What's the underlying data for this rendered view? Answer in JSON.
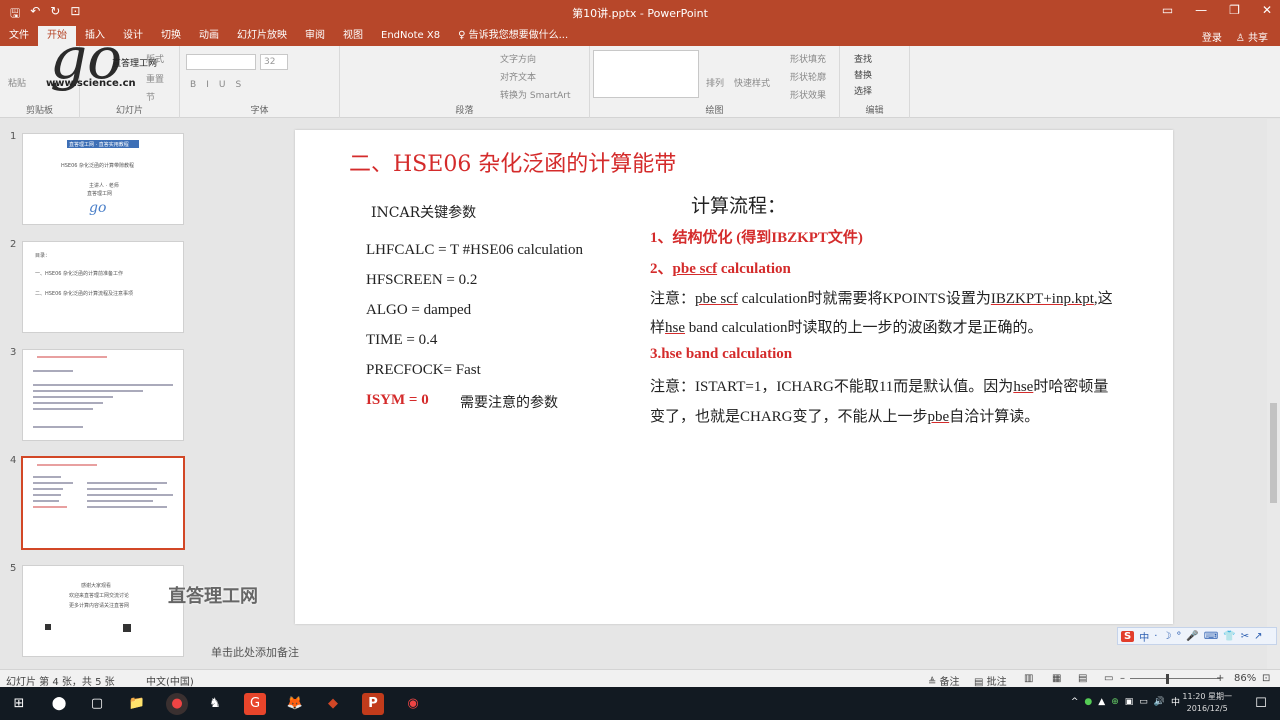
{
  "window": {
    "title": "第10讲.pptx - PowerPoint",
    "controls": [
      "▭",
      "—",
      "❐",
      "✕"
    ]
  },
  "tabs": {
    "items": [
      "文件",
      "开始",
      "插入",
      "设计",
      "切换",
      "动画",
      "幻灯片放映",
      "审阅",
      "视图",
      "EndNote X8",
      "♀ 告诉我您想要做什么..."
    ],
    "active_index": 1,
    "login": "登录",
    "share": "♙ 共享"
  },
  "ribbon": {
    "clipboard": {
      "label": "剪贴板",
      "paste": "粘贴"
    },
    "slides": {
      "label": "幻灯片",
      "new_slide": "新建",
      "layout": "版式",
      "reset": "重置",
      "section": "节",
      "slide": "幻灯片"
    },
    "font": {
      "label": "字体",
      "size": "32",
      "styles": [
        "B",
        "I",
        "U",
        "S",
        "abc",
        "AV",
        "Aa",
        "A"
      ]
    },
    "paragraph": {
      "label": "段落",
      "text_direction": "文字方向",
      "align_text": "对齐文本",
      "smartart": "转换为 SmartArt"
    },
    "drawing": {
      "label": "绘图",
      "arrange": "排列",
      "quick_styles": "快速样式",
      "fill": "形状填充",
      "outline": "形状轮廓",
      "effects": "形状效果"
    },
    "editing": {
      "label": "编辑",
      "find": "查找",
      "replace": "替换",
      "select": "选择"
    }
  },
  "logo": {
    "main": "go",
    "url": "www.science.cn",
    "name": "直答理工网"
  },
  "thumbnails": [
    {
      "num": "1",
      "lines": [
        "直答理工网 · 直答实用教程",
        "HSE06 杂化泛函的计算带隙教程",
        "主讲人 · 老师",
        "直答理工网"
      ],
      "logo": "go"
    },
    {
      "num": "2",
      "lines": [
        "目录：",
        "一、HSE06 杂化泛函的计算前准备工作",
        "二、HSE06 杂化泛函的计算流程及注意事项"
      ]
    },
    {
      "num": "3",
      "lines": []
    },
    {
      "num": "4",
      "lines": [],
      "selected": true
    },
    {
      "num": "5",
      "lines": [
        "感谢大家观看",
        "欢迎来直答理工网交流讨论",
        "更多计算内容请关注直答网"
      ]
    }
  ],
  "slide": {
    "heading": "二、HSE06 杂化泛函的计算能带",
    "incar_title": "INCAR关键参数",
    "params": [
      "LHFCALC = T    #HSE06 calculation",
      "HFSCREEN = 0.2",
      "ALGO = damped",
      "TIME = 0.4",
      "PRECFOCK= Fast"
    ],
    "isym": "ISYM = 0",
    "isym_note": "需要注意的参数",
    "flow_title": "计算流程：",
    "step1": "1、结构优化 (得到IBZKPT文件)",
    "step2_prefix": "2、",
    "step2_ul": "pbe scf",
    "step2_suffix": " calculation",
    "note1_a": "注意：",
    "note1_b": "pbe scf",
    "note1_c": " calculation时就需要将KPOINTS设置为",
    "note1_d": "IBZKPT+inp.kpt",
    "note1_e": ",这",
    "note2_a": "样",
    "note2_b": "hse",
    "note2_c": " band calculation时读取的上一步的波函数才是正确的。",
    "step3": "3.hse band calculation",
    "note3_a": "注意：ISTART=1，ICHARG不能取11而是默认值。因为",
    "note3_b": "hse",
    "note3_c": "时哈密顿量",
    "note4_a": "变了，也就是CHARG变了，不能从上一步",
    "note4_b": "pbe",
    "note4_c": "自洽计算读。"
  },
  "watermark": "直答理工网",
  "notes_placeholder": "单击此处添加备注",
  "statusbar": {
    "slide_info": "幻灯片 第 4 张，共 5 张",
    "language": "中文(中国)",
    "notes": "≜ 备注",
    "comments": "▤ 批注",
    "zoom": "86%",
    "zoom_fraction": 0.4
  },
  "ime": {
    "logo": "S",
    "items": [
      "中",
      "·",
      "☽",
      "°",
      "🎤",
      "⌨",
      "👕",
      "✂",
      "↗"
    ]
  },
  "taskbar": {
    "start": "⊞",
    "search": "⬤",
    "taskview": "▢",
    "apps": [
      "📁",
      "●",
      "♞",
      "G",
      "🦊",
      "◆",
      "P",
      "◉"
    ],
    "tray": [
      "^",
      "●",
      "▲",
      "⊕",
      "▣",
      "▭",
      "🔊",
      "中"
    ],
    "time": "11:20 星期一",
    "date": "2016/12/5",
    "notify": "☐"
  },
  "colors": {
    "accent": "#b7472a",
    "slide_red": "#d42b2b"
  }
}
